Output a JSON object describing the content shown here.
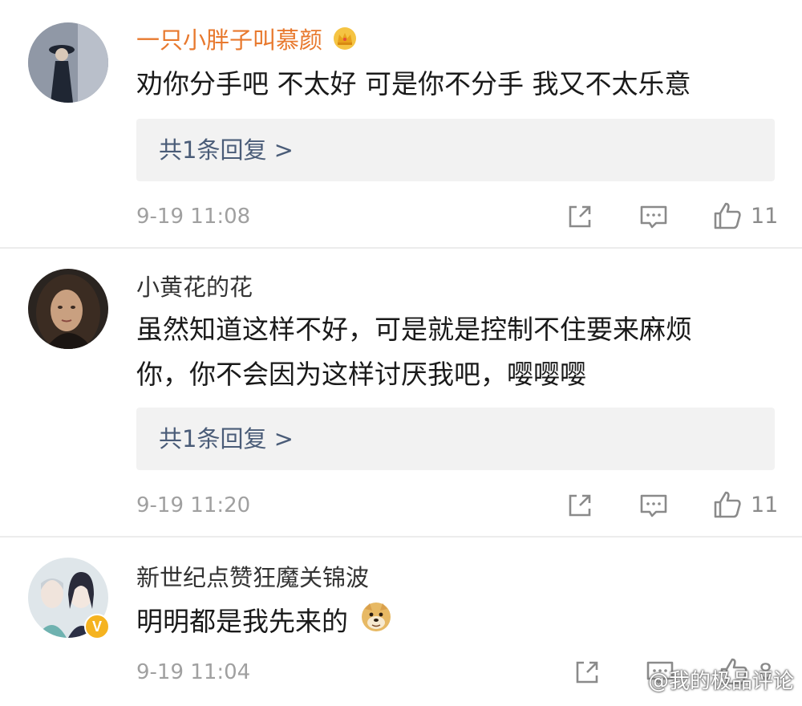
{
  "comments": [
    {
      "username": "一只小胖子叫慕颜",
      "username_color": "#e8792e",
      "text_lines": [
        "劝你分手吧 不太好 可是你不分手 我又不太乐意"
      ],
      "reply_label": "共1条回复 >",
      "time": "9-19 11:08",
      "likes": "11",
      "badge_icon": "crown-icon"
    },
    {
      "username": "小黄花的花",
      "username_color": "#333333",
      "text_lines": [
        "虽然知道这样不好，可是就是控制不住要来麻烦",
        "你，你不会因为这样讨厌我吧，嘤嘤嘤"
      ],
      "reply_label": "共1条回复 >",
      "time": "9-19 11:20",
      "likes": "11"
    },
    {
      "username": "新世纪点赞狂魔关锦波",
      "username_color": "#333333",
      "text_lines": [
        "明明都是我先来的"
      ],
      "time": "9-19 11:04",
      "likes": "8",
      "emoji_icon": "doge-icon",
      "verified_badge": "V"
    }
  ],
  "watermark": "@我的极品评论",
  "colors": {
    "reply_link": "#4a5c78",
    "timestamp": "#a0a0a0",
    "divider": "#ececec"
  }
}
